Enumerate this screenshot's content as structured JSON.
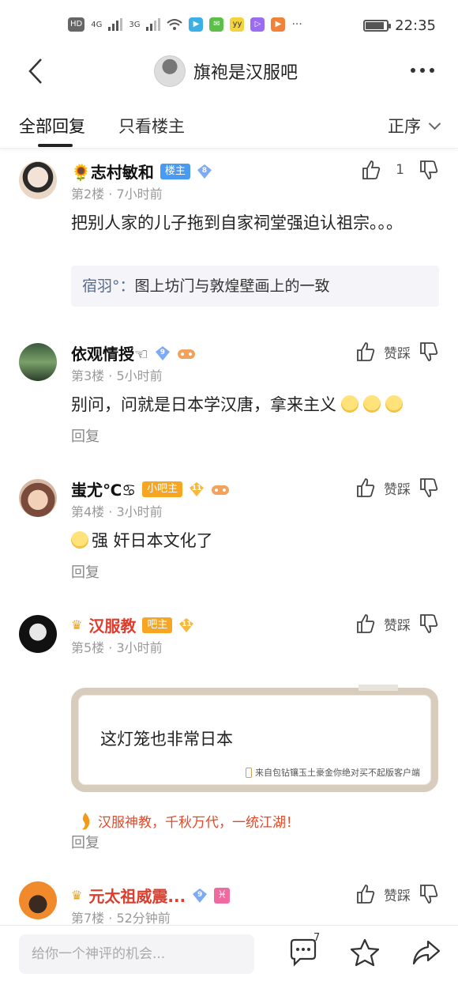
{
  "status_bar": {
    "left_chips": [
      "HD",
      "4G",
      "3G"
    ],
    "time": "22:35"
  },
  "header": {
    "title": "旗袍是汉服吧"
  },
  "tabs": {
    "all": "全部回复",
    "op_only": "只看楼主",
    "sort": "正序"
  },
  "posts": [
    {
      "name": "🌻志村敏和",
      "badge": "楼主",
      "level": "8",
      "meta": "第2楼 · 7小时前",
      "content": "把别人家的儿子拖到自家祠堂强迫认祖宗。。。",
      "likes": "1",
      "quote_name": "宿羽°：",
      "quote_text": "图上坊门与敦煌壁画上的一致"
    },
    {
      "name": "依观情授☜",
      "level": "9",
      "meta": "第3楼 · 5小时前",
      "content": "别问，问就是日本学汉唐，拿来主义",
      "action_label": "赞踩",
      "reply": "回复"
    },
    {
      "name": "蚩尤℃♋",
      "badge": "小吧主",
      "level": "11",
      "meta": "第4楼 · 3小时前",
      "content": "强 奸日本文化了",
      "action_label": "赞踩",
      "reply": "回复"
    },
    {
      "name": "汉服教",
      "badge": "吧主",
      "level": "11",
      "meta": "第5楼 · 3小时前",
      "card_text": "这灯笼也非常日本",
      "card_source": "来自包钻镶玉土豪金你绝对买不起版客户端",
      "slogan": "汉服神教，千秋万代，一统江湖！",
      "action_label": "赞踩",
      "reply": "回复"
    },
    {
      "name": "元太祖威震...",
      "level": "9",
      "meta": "第7楼 · 52分钟前",
      "action_label": "赞踩"
    }
  ],
  "bottom_bar": {
    "placeholder": "给你一个神评的机会...",
    "comment_count": "7"
  },
  "colors": {
    "op_badge": "#4a9bf0",
    "mod_badge": "#f6a623",
    "admin_badge": "#f6a623",
    "red_name": "#e03c2c",
    "slogan": "#e04a2a"
  }
}
